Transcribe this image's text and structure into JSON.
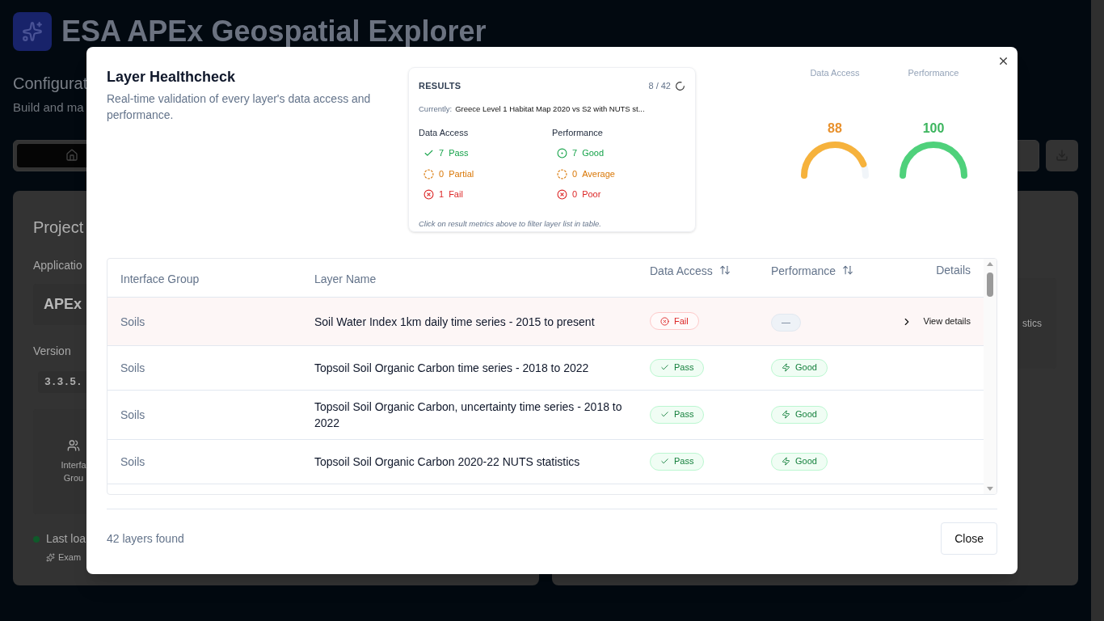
{
  "background": {
    "app_title": "ESA APEx Geospatial Explorer",
    "page_title": "Configurat",
    "page_subtitle": "Build and ma",
    "card_title": "Project",
    "fields": [
      {
        "label": "Applicatio",
        "value": "APEx",
        "kind": "text"
      },
      {
        "label": "Version",
        "value": "3.3.5.",
        "kind": "code"
      }
    ],
    "stat_label": "Interfa Grou",
    "status": "Last loa",
    "note": "Exam",
    "right_card_text": "stics"
  },
  "modal": {
    "title": "Layer Healthcheck",
    "subtitle": "Real-time validation of every layer's data access and performance.",
    "results": {
      "heading": "RESULTS",
      "progress": "8 / 42",
      "current_label": "Currently:",
      "current_value": "Greece Level 1 Habitat Map 2020 vs S2 with NUTS st...",
      "groups": [
        {
          "title": "Data Access",
          "items": [
            {
              "kind": "pass",
              "count": "7",
              "label": "Pass"
            },
            {
              "kind": "partial",
              "count": "0",
              "label": "Partial"
            },
            {
              "kind": "fail",
              "count": "1",
              "label": "Fail"
            }
          ]
        },
        {
          "title": "Performance",
          "items": [
            {
              "kind": "good",
              "count": "7",
              "label": "Good"
            },
            {
              "kind": "average",
              "count": "0",
              "label": "Average"
            },
            {
              "kind": "poor",
              "count": "0",
              "label": "Poor"
            }
          ]
        }
      ],
      "hint": "Click on result metrics above to filter layer list in table."
    },
    "gauges": [
      {
        "label": "Data Access",
        "value": "88",
        "level": 0.88,
        "kind": "average"
      },
      {
        "label": "Performance",
        "value": "100",
        "level": 1,
        "kind": "good"
      }
    ],
    "table": {
      "columns": [
        {
          "label": "Interface Group",
          "sortable": false
        },
        {
          "label": "Layer Name",
          "sortable": false
        },
        {
          "label": "Data Access",
          "sortable": true
        },
        {
          "label": "Performance",
          "sortable": true
        },
        {
          "label": "Details",
          "sortable": false
        }
      ],
      "rows": [
        {
          "group": "Soils",
          "name": "Soil Water Index 1km daily time series - 2015 to present",
          "data_access": {
            "kind": "fail",
            "label": "Fail"
          },
          "performance": {
            "kind": "none",
            "label": "—"
          },
          "details": "View details"
        },
        {
          "group": "Soils",
          "name": "Topsoil Soil Organic Carbon time series - 2018 to 2022",
          "data_access": {
            "kind": "pass",
            "label": "Pass"
          },
          "performance": {
            "kind": "good",
            "label": "Good"
          }
        },
        {
          "group": "Soils",
          "name": "Topsoil Soil Organic Carbon, uncertainty time series - 2018 to 2022",
          "data_access": {
            "kind": "pass",
            "label": "Pass"
          },
          "performance": {
            "kind": "good",
            "label": "Good"
          }
        },
        {
          "group": "Soils",
          "name": "Topsoil Soil Organic Carbon 2020-22 NUTS statistics",
          "data_access": {
            "kind": "pass",
            "label": "Pass"
          },
          "performance": {
            "kind": "good",
            "label": "Good"
          }
        }
      ]
    },
    "footer": {
      "count": "42 layers found",
      "close_button": "Close"
    }
  }
}
